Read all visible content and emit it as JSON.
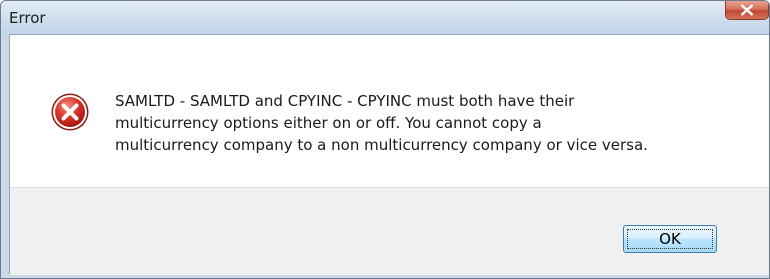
{
  "window": {
    "title": "Error"
  },
  "dialog": {
    "icon": "error-icon",
    "message_lines": [
      "SAMLTD - SAMLTD and CPYINC - CPYINC must both have their",
      "multicurrency options either on or off. You cannot copy a",
      "multicurrency company to a non multicurrency company or vice versa."
    ],
    "ok_label": "OK"
  },
  "colors": {
    "titlebar": "#c9d9ea",
    "close_button": "#c2472f",
    "error_icon": "#c8231c",
    "button_area": "#f0f0f0"
  }
}
